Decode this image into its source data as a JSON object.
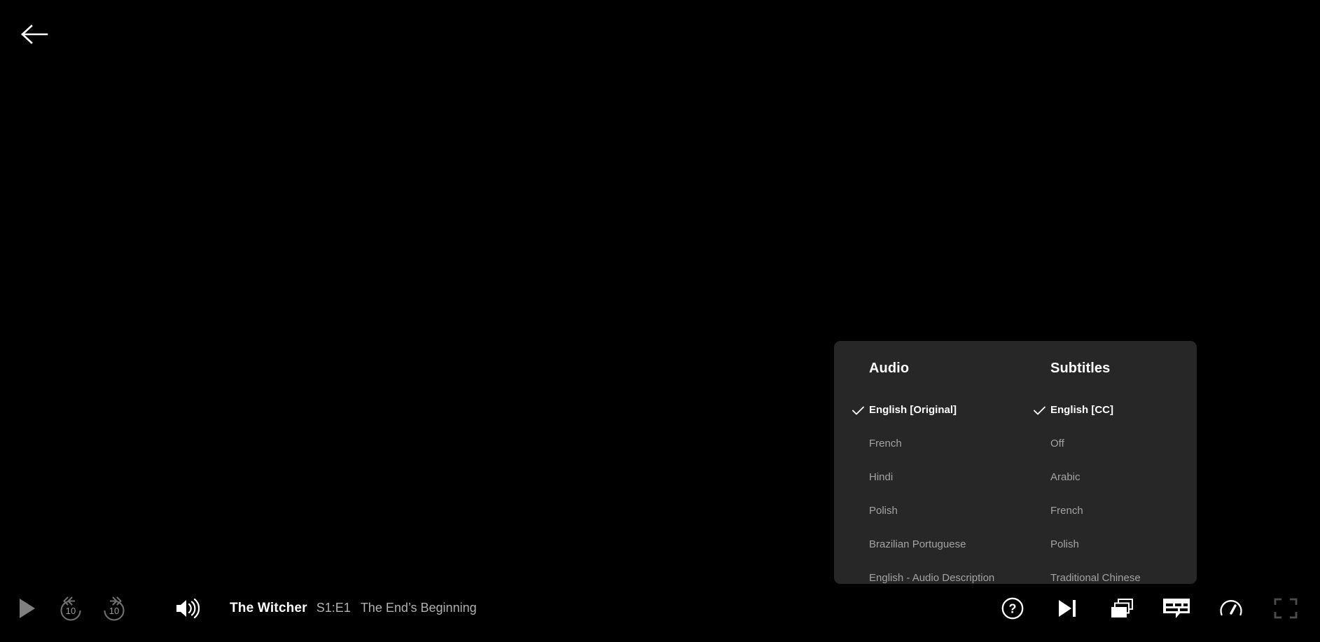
{
  "colors": {
    "background": "#000000",
    "panel_bg": "#272727",
    "text_primary": "#ffffff",
    "text_secondary": "#a3a3a3",
    "icon_dim": "#808080",
    "icon_faint": "#4d4d4d",
    "icon_active": "#ffffff"
  },
  "navigation": {
    "back_label": "Back",
    "back_icon": "arrow-left-icon"
  },
  "settings_panel": {
    "audio": {
      "header": "Audio",
      "options": [
        {
          "label": "English [Original]",
          "selected": true
        },
        {
          "label": "French",
          "selected": false
        },
        {
          "label": "Hindi",
          "selected": false
        },
        {
          "label": "Polish",
          "selected": false
        },
        {
          "label": "Brazilian Portuguese",
          "selected": false
        },
        {
          "label": "English - Audio Description",
          "selected": false
        }
      ]
    },
    "subtitles": {
      "header": "Subtitles",
      "options": [
        {
          "label": "English [CC]",
          "selected": true
        },
        {
          "label": "Off",
          "selected": false
        },
        {
          "label": "Arabic",
          "selected": false
        },
        {
          "label": "French",
          "selected": false
        },
        {
          "label": "Polish",
          "selected": false
        },
        {
          "label": "Traditional Chinese",
          "selected": false
        }
      ]
    }
  },
  "controls": {
    "play": {
      "label": "Play",
      "icon": "play-icon"
    },
    "rewind": {
      "label": "Rewind 10 seconds",
      "icon": "rewind-10-icon",
      "seconds": "10"
    },
    "forward": {
      "label": "Forward 10 seconds",
      "icon": "forward-10-icon",
      "seconds": "10"
    },
    "volume": {
      "label": "Volume",
      "icon": "volume-high-icon"
    },
    "help": {
      "label": "Help",
      "icon": "help-circle-icon"
    },
    "next_episode": {
      "label": "Next Episode",
      "icon": "next-episode-icon"
    },
    "episodes": {
      "label": "Episodes",
      "icon": "episodes-icon"
    },
    "subtitles_toggle": {
      "label": "Audio and Subtitles",
      "icon": "subtitles-icon"
    },
    "speed": {
      "label": "Playback Speed",
      "icon": "speed-gauge-icon"
    },
    "fullscreen": {
      "label": "Fullscreen",
      "icon": "fullscreen-icon"
    }
  },
  "now_playing": {
    "show_title": "The Witcher",
    "episode_code": "S1:E1",
    "episode_title": "The End’s Beginning"
  }
}
